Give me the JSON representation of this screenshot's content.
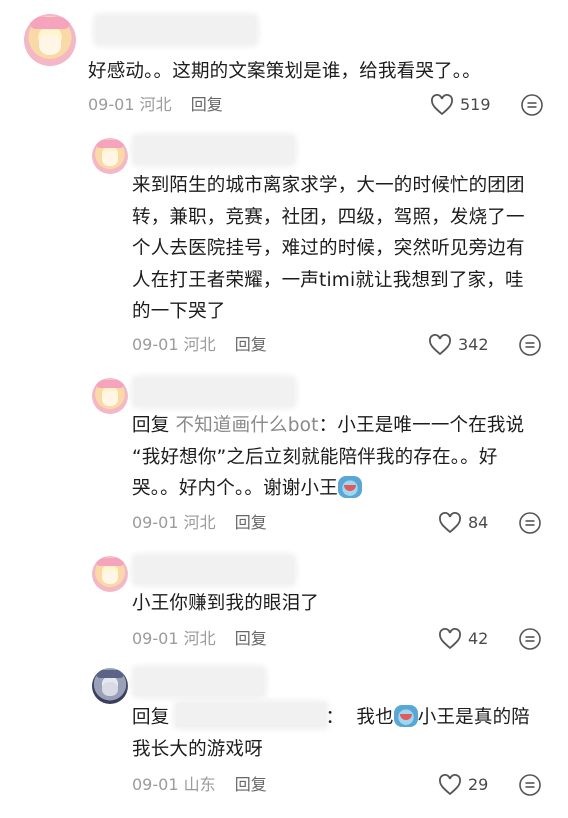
{
  "comments": [
    {
      "text": "好感动。。这期的文案策划是谁，给我看哭了。。",
      "date": "09-01",
      "location": "河北",
      "reply_label": "回复",
      "likes": "519"
    },
    {
      "text": "来到陌生的城市离家求学，大一的时候忙的团团\n转，兼职，竞赛，社团，四级，驾照，发烧了一\n个人去医院挂号，难过的时候，突然听见旁边有\n人在打王者荣耀，一声timi就让我想到了家，哇\n的一下哭了",
      "date": "09-01",
      "location": "河北",
      "reply_label": "回复",
      "likes": "342"
    },
    {
      "reply_kw": "回复",
      "reply_target": "不知道画什么bot",
      "text_after": "：小王是唯一一个在我说\n“我好想你”之后立刻就能陪伴我的存在。。好\n哭。。好内个。。谢谢小王",
      "date": "09-01",
      "location": "河北",
      "reply_label": "回复",
      "likes": "84"
    },
    {
      "text": "小王你赚到我的眼泪了",
      "date": "09-01",
      "location": "河北",
      "reply_label": "回复",
      "likes": "42"
    },
    {
      "reply_kw": "回复",
      "text_mid": "：  我也",
      "text_after": "小王是真的陪\n我长大的游戏呀",
      "date": "09-01",
      "location": "山东",
      "reply_label": "回复",
      "likes": "29"
    }
  ],
  "icons": {
    "like": "heart-outline-icon",
    "more": "more-dots-icon",
    "emoji": "crying-emoji-icon"
  },
  "colors": {
    "meta": "#9b9b9b",
    "text": "#1c1c1c",
    "reply_target": "#8a8a8a"
  }
}
